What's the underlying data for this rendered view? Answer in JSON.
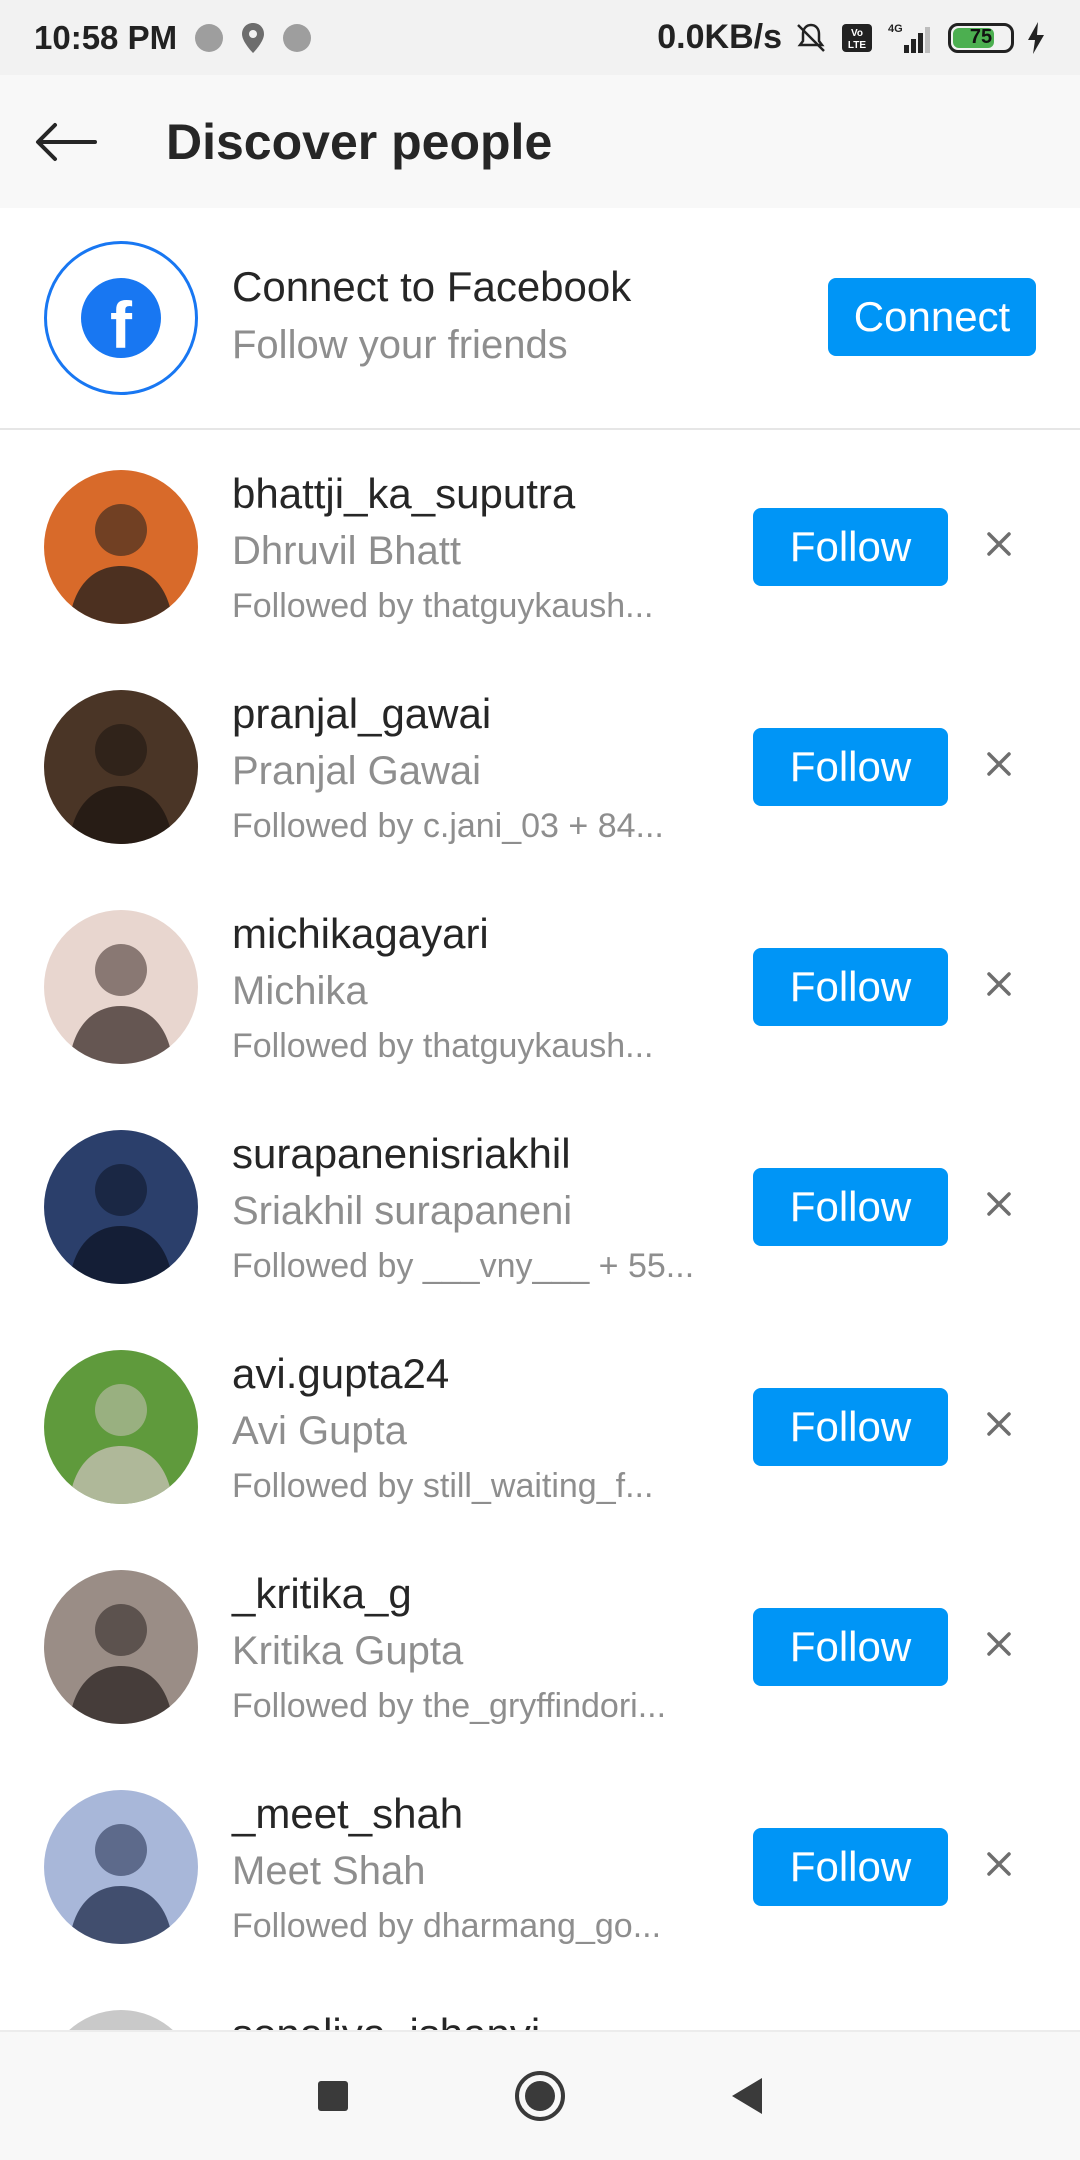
{
  "status_bar": {
    "time": "10:58 PM",
    "net_speed": "0.0KB/s",
    "network": "4G",
    "volte": "VoLTE",
    "battery_percent": "75",
    "battery_level": 0.75
  },
  "header": {
    "title": "Discover people",
    "back_icon": "arrow-left-icon"
  },
  "facebook": {
    "title": "Connect to Facebook",
    "subtitle": "Follow your friends",
    "button_label": "Connect",
    "logo_glyph": "f"
  },
  "suggestions": [
    {
      "username": "bhattji_ka_suputra",
      "full_name": "Dhruvil Bhatt",
      "followed_by": "Followed by thatguykaush...",
      "button": "Follow",
      "avatar_colors": [
        "#d86a2a",
        "#1d1d1d"
      ]
    },
    {
      "username": "pranjal_gawai",
      "full_name": "Pranjal Gawai",
      "followed_by": "Followed by c.jani_03 + 84...",
      "button": "Follow",
      "avatar_colors": [
        "#4a3526",
        "#1c1410"
      ]
    },
    {
      "username": "michikagayari",
      "full_name": "Michika",
      "followed_by": "Followed by thatguykaush...",
      "button": "Follow",
      "avatar_colors": [
        "#e8d6cf",
        "#3a2b28"
      ]
    },
    {
      "username": "surapanenisriakhil",
      "full_name": "Sriakhil surapaneni",
      "followed_by": "Followed by ___vny___ + 55...",
      "button": "Follow",
      "avatar_colors": [
        "#2b3f6b",
        "#0d1424"
      ]
    },
    {
      "username": "avi.gupta24",
      "full_name": "Avi Gupta",
      "followed_by": "Followed by still_waiting_f...",
      "button": "Follow",
      "avatar_colors": [
        "#5f9a3c",
        "#c9c2b8"
      ]
    },
    {
      "username": "_kritika_g",
      "full_name": "Kritika Gupta",
      "followed_by": "Followed by the_gryffindori...",
      "button": "Follow",
      "avatar_colors": [
        "#9a8d86",
        "#2a2320"
      ]
    },
    {
      "username": "_meet_shah",
      "full_name": "Meet Shah",
      "followed_by": "Followed by dharmang_go...",
      "button": "Follow",
      "avatar_colors": [
        "#a8b7d9",
        "#1f2b4a"
      ]
    },
    {
      "username": "sonaliya_ishanvi",
      "full_name": "",
      "followed_by": "",
      "button": "",
      "avatar_colors": [
        "#c9c9c9",
        "#7a7a7a"
      ]
    }
  ],
  "navbar": {
    "recent_icon": "square-icon",
    "home_icon": "circle-home-icon",
    "back_icon": "triangle-back-icon"
  },
  "colors": {
    "accent": "#0095f6",
    "facebook": "#1877f2",
    "secondary_text": "#8e8e8e"
  }
}
